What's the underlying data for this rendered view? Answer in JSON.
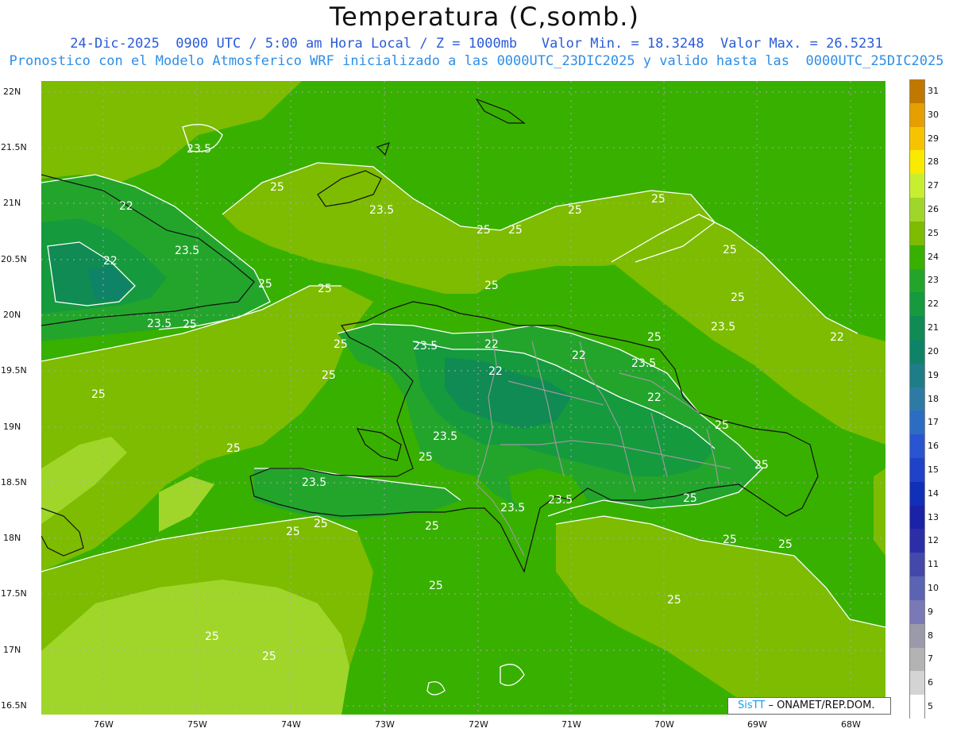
{
  "header": {
    "title": "Temperatura (C,somb.)",
    "subtitle1": "24-Dic-2025  0900 UTC / 5:00 am Hora Local / Z = 1000mb   Valor Min. = 18.3248  Valor Max. = 26.5231",
    "subtitle2": "Pronostico con el Modelo Atmosferico WRF inicializado a las 0000UTC_23DIC2025 y valido hasta las  0000UTC_25DIC2025"
  },
  "axes": {
    "y_labels": [
      "22N",
      "21.5N",
      "21N",
      "20.5N",
      "20N",
      "19.5N",
      "19N",
      "18.5N",
      "18N",
      "17.5N",
      "17N",
      "16.5N"
    ],
    "x_labels": [
      "76W",
      "75W",
      "74W",
      "73W",
      "72W",
      "71W",
      "70W",
      "69W",
      "68W"
    ]
  },
  "colorbar": {
    "levels": [
      "31",
      "30",
      "29",
      "28",
      "27",
      "26",
      "25",
      "24",
      "23",
      "22",
      "21",
      "20",
      "19",
      "18",
      "17",
      "16",
      "15",
      "14",
      "13",
      "12",
      "11",
      "10",
      "9",
      "8",
      "7",
      "6",
      "5"
    ],
    "colors": [
      "#c07800",
      "#e59f00",
      "#f7c300",
      "#f9ea00",
      "#c8ee30",
      "#a0d62a",
      "#7dbc00",
      "#38b000",
      "#23a52c",
      "#159a3e",
      "#0f8b53",
      "#0f8367",
      "#1e7d86",
      "#2d7ba5",
      "#2d6cc3",
      "#2a55d0",
      "#1f42c9",
      "#1030b8",
      "#1a22a8",
      "#2b2ea6",
      "#4448aa",
      "#5b63b3",
      "#7a78b6",
      "#9a9aaa",
      "#b3b3b3",
      "#d4d4d4",
      "#ffffff"
    ]
  },
  "contour_labels": [
    "23.5",
    "25",
    "22",
    "23.5",
    "25",
    "25",
    "25",
    "25",
    "25",
    "25",
    "22",
    "23.5",
    "25",
    "23.5",
    "25",
    "25",
    "25",
    "23.5",
    "25",
    "22",
    "23.5",
    "25",
    "22",
    "22",
    "23.5",
    "25",
    "22",
    "22",
    "25",
    "25",
    "23.5",
    "25",
    "25",
    "23.5",
    "23.5",
    "23.5",
    "25",
    "25",
    "25",
    "25",
    "25",
    "25",
    "25",
    "25",
    "25",
    "25",
    "25"
  ],
  "credit": {
    "brand": "SisTT",
    "text": "– ONAMET/REP.DOM."
  }
}
